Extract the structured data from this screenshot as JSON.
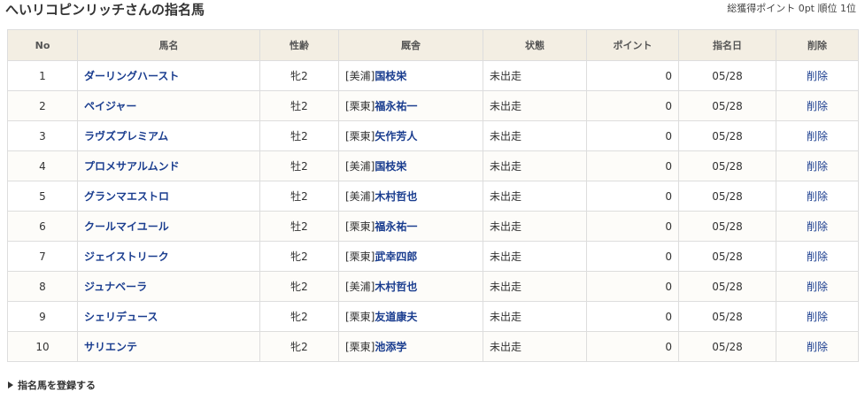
{
  "header": {
    "title": "へいリコピンリッチさんの指名馬",
    "summary": "総獲得ポイント 0pt 順位 1位"
  },
  "table": {
    "columns": [
      "No",
      "馬名",
      "性齢",
      "厩舎",
      "状態",
      "ポイント",
      "指名日",
      "削除"
    ],
    "rows": [
      {
        "no": "1",
        "name": "ダーリングハースト",
        "sex_age": "牝2",
        "region": "[美浦]",
        "trainer": "国枝栄",
        "status": "未出走",
        "points": "0",
        "date": "05/28",
        "delete": "削除"
      },
      {
        "no": "2",
        "name": "ペイジャー",
        "sex_age": "牡2",
        "region": "[栗東]",
        "trainer": "福永祐一",
        "status": "未出走",
        "points": "0",
        "date": "05/28",
        "delete": "削除"
      },
      {
        "no": "3",
        "name": "ラヴズプレミアム",
        "sex_age": "牡2",
        "region": "[栗東]",
        "trainer": "矢作芳人",
        "status": "未出走",
        "points": "0",
        "date": "05/28",
        "delete": "削除"
      },
      {
        "no": "4",
        "name": "プロメサアルムンド",
        "sex_age": "牡2",
        "region": "[美浦]",
        "trainer": "国枝栄",
        "status": "未出走",
        "points": "0",
        "date": "05/28",
        "delete": "削除"
      },
      {
        "no": "5",
        "name": "グランマエストロ",
        "sex_age": "牡2",
        "region": "[美浦]",
        "trainer": "木村哲也",
        "status": "未出走",
        "points": "0",
        "date": "05/28",
        "delete": "削除"
      },
      {
        "no": "6",
        "name": "クールマイユール",
        "sex_age": "牡2",
        "region": "[栗東]",
        "trainer": "福永祐一",
        "status": "未出走",
        "points": "0",
        "date": "05/28",
        "delete": "削除"
      },
      {
        "no": "7",
        "name": "ジェイストリーク",
        "sex_age": "牝2",
        "region": "[栗東]",
        "trainer": "武幸四郎",
        "status": "未出走",
        "points": "0",
        "date": "05/28",
        "delete": "削除"
      },
      {
        "no": "8",
        "name": "ジュナベーラ",
        "sex_age": "牝2",
        "region": "[美浦]",
        "trainer": "木村哲也",
        "status": "未出走",
        "points": "0",
        "date": "05/28",
        "delete": "削除"
      },
      {
        "no": "9",
        "name": "シェリデュース",
        "sex_age": "牝2",
        "region": "[栗東]",
        "trainer": "友道康夫",
        "status": "未出走",
        "points": "0",
        "date": "05/28",
        "delete": "削除"
      },
      {
        "no": "10",
        "name": "サリエンテ",
        "sex_age": "牝2",
        "region": "[栗東]",
        "trainer": "池添学",
        "status": "未出走",
        "points": "0",
        "date": "05/28",
        "delete": "削除"
      }
    ]
  },
  "footer": {
    "register_label": "指名馬を登録する",
    "register_icon": "triangle-right-icon"
  },
  "colors": {
    "header_bg": "#f3eee3",
    "link": "#1a3d8f",
    "border": "#dddddd"
  }
}
